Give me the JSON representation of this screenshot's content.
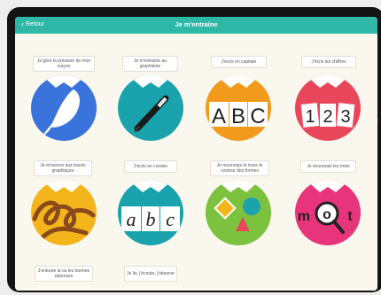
{
  "navbar": {
    "back_label": "Retour",
    "title": "Je m'entraîne"
  },
  "activities": [
    {
      "label": "Je gère la pression de mon crayon",
      "icon": "feather-icon"
    },
    {
      "label": "Je m'entraîne au graphisme",
      "icon": "pen-icon"
    },
    {
      "label": "J'écris en capitale",
      "icon": "abc-capital-icon",
      "letters": [
        "A",
        "B",
        "C"
      ]
    },
    {
      "label": "J'écris les chiffres",
      "icon": "numbers-icon",
      "letters": [
        "1",
        "2",
        "3"
      ]
    },
    {
      "label": "Je m'exerce aux tracés graphiques",
      "icon": "rope-loops-icon"
    },
    {
      "label": "J'écris en cursive",
      "icon": "abc-cursive-icon",
      "letters": [
        "a",
        "b",
        "c"
      ]
    },
    {
      "label": "Je reconnais et trace le contour des formes",
      "icon": "shapes-icon"
    },
    {
      "label": "Je reconnais les mots",
      "icon": "magnifier-word-icon",
      "letters": [
        "m",
        "o",
        "t"
      ]
    },
    {
      "label": "J'entoure la ou les bonnes réponses",
      "icon": ""
    },
    {
      "label": "Je lis, j'écoute, j'observe",
      "icon": ""
    }
  ],
  "colors": {
    "navbar": "#2fb7a8",
    "blue": "#3a73db",
    "teal": "#1aa3ad",
    "orange": "#f29a1c",
    "red": "#e8475b",
    "yellow": "#f3b51b",
    "green": "#7cc23e",
    "pink": "#e8347a"
  }
}
